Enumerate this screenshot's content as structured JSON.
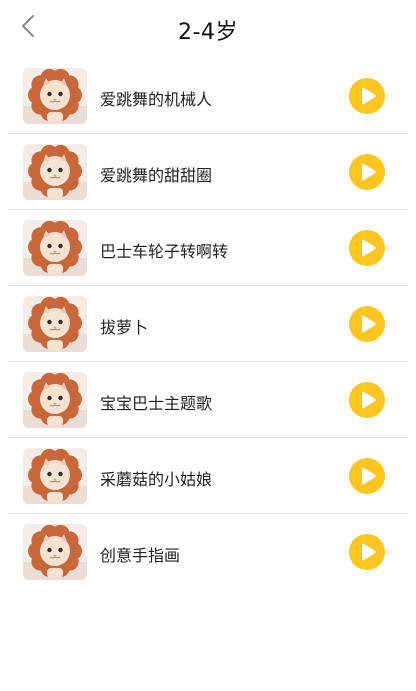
{
  "header": {
    "title": "2-4岁",
    "back_icon": "chevron-left-icon"
  },
  "colors": {
    "accent": "#FFC51F",
    "play_icon": "#ffffff",
    "divider": "#e4e4e4",
    "petal": "#C8683A"
  },
  "songs": [
    {
      "title": "爱跳舞的机械人",
      "thumb_icon": "flower-cat-thumbnail",
      "action_icon": "play-icon"
    },
    {
      "title": "爱跳舞的甜甜圈",
      "thumb_icon": "flower-cat-thumbnail",
      "action_icon": "play-icon"
    },
    {
      "title": "巴士车轮子转啊转",
      "thumb_icon": "flower-cat-thumbnail",
      "action_icon": "play-icon"
    },
    {
      "title": "拔萝卜",
      "thumb_icon": "flower-cat-thumbnail",
      "action_icon": "play-icon"
    },
    {
      "title": "宝宝巴士主题歌",
      "thumb_icon": "flower-cat-thumbnail",
      "action_icon": "play-icon"
    },
    {
      "title": "采蘑菇的小姑娘",
      "thumb_icon": "flower-cat-thumbnail",
      "action_icon": "play-icon"
    },
    {
      "title": "创意手指画",
      "thumb_icon": "flower-cat-thumbnail",
      "action_icon": "play-icon"
    }
  ]
}
